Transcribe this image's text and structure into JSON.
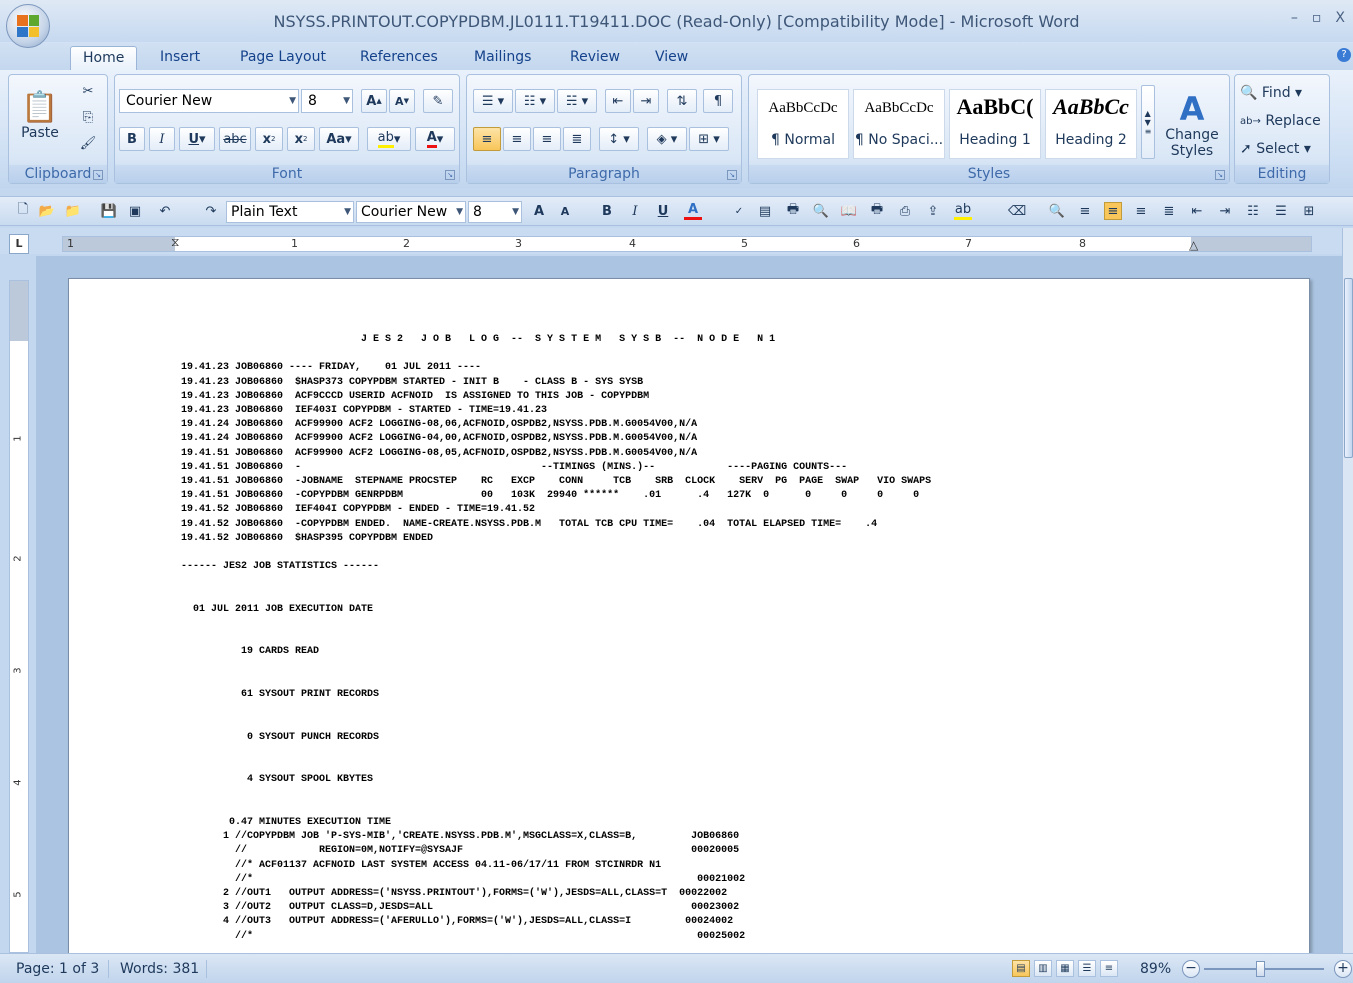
{
  "window": {
    "title": "NSYSS.PRINTOUT.COPYPDBM.JL0111.T19411.DOC (Read-Only) [Compatibility Mode] - Microsoft Word",
    "controls": {
      "minimize": "–",
      "maximize": "▫",
      "close": "X"
    }
  },
  "tabs": [
    "Home",
    "Insert",
    "Page Layout",
    "References",
    "Mailings",
    "Review",
    "View"
  ],
  "active_tab": "Home",
  "ribbon": {
    "clipboard": {
      "label": "Clipboard",
      "paste": "Paste"
    },
    "font": {
      "label": "Font",
      "font_name": "Courier New",
      "font_size": "8"
    },
    "paragraph": {
      "label": "Paragraph"
    },
    "styles": {
      "label": "Styles",
      "gallery": [
        {
          "sample": "AaBbCcDc",
          "name": "¶ Normal"
        },
        {
          "sample": "AaBbCcDc",
          "name": "¶ No Spaci..."
        },
        {
          "sample": "AaBbC(",
          "name": "Heading 1"
        },
        {
          "sample": "AaBbCc",
          "name": "Heading 2"
        }
      ],
      "change_styles": "Change",
      "change_styles2": "Styles"
    },
    "editing": {
      "label": "Editing",
      "find": "Find",
      "replace": "Replace",
      "select": "Select"
    }
  },
  "quick_toolbar": {
    "style": "Plain Text",
    "font": "Courier New",
    "size": "8"
  },
  "ruler": {
    "numbers": [
      "1",
      "1",
      "2",
      "3",
      "4",
      "5",
      "6",
      "7",
      "8"
    ]
  },
  "vruler": {
    "numbers": [
      "1",
      "2",
      "3",
      "4",
      "5"
    ]
  },
  "document": {
    "lines": [
      "                              J E S 2   J O B   L O G  --  S Y S T E M   S Y S B  --  N O D E   N 1",
      "",
      "19.41.23 JOB06860 ---- FRIDAY,    01 JUL 2011 ----",
      "19.41.23 JOB06860  $HASP373 COPYPDBM STARTED - INIT B    - CLASS B - SYS SYSB",
      "19.41.23 JOB06860  ACF9CCCD USERID ACFNOID  IS ASSIGNED TO THIS JOB - COPYPDBM",
      "19.41.23 JOB06860  IEF403I COPYPDBM - STARTED - TIME=19.41.23",
      "19.41.24 JOB06860  ACF99900 ACF2 LOGGING-08,06,ACFNOID,OSPDB2,NSYSS.PDB.M.G0054V00,N/A",
      "19.41.24 JOB06860  ACF99900 ACF2 LOGGING-04,00,ACFNOID,OSPDB2,NSYSS.PDB.M.G0054V00,N/A",
      "19.41.51 JOB06860  ACF99900 ACF2 LOGGING-08,05,ACFNOID,OSPDB2,NSYSS.PDB.M.G0054V00,N/A",
      "19.41.51 JOB06860  -                                        --TIMINGS (MINS.)--            ----PAGING COUNTS---",
      "19.41.51 JOB06860  -JOBNAME  STEPNAME PROCSTEP    RC   EXCP    CONN     TCB    SRB  CLOCK    SERV  PG  PAGE  SWAP   VIO SWAPS",
      "19.41.51 JOB06860  -COPYPDBM GENRPDBM             00   103K  29940 ******    .01      .4   127K  0      0     0     0     0",
      "19.41.52 JOB06860  IEF404I COPYPDBM - ENDED - TIME=19.41.52",
      "19.41.52 JOB06860  -COPYPDBM ENDED.  NAME-CREATE.NSYSS.PDB.M   TOTAL TCB CPU TIME=    .04  TOTAL ELAPSED TIME=    .4",
      "19.41.52 JOB06860  $HASP395 COPYPDBM ENDED",
      "",
      "------ JES2 JOB STATISTICS ------",
      "",
      "",
      "  01 JUL 2011 JOB EXECUTION DATE",
      "",
      "",
      "          19 CARDS READ",
      "",
      "",
      "          61 SYSOUT PRINT RECORDS",
      "",
      "",
      "           0 SYSOUT PUNCH RECORDS",
      "",
      "",
      "           4 SYSOUT SPOOL KBYTES",
      "",
      "",
      "        0.47 MINUTES EXECUTION TIME",
      "       1 //COPYPDBM JOB 'P-SYS-MIB','CREATE.NSYSS.PDB.M',MSGCLASS=X,CLASS=B,         JOB06860",
      "         //            REGION=0M,NOTIFY=@SYSAJF                                      00020005",
      "         //* ACF01137 ACFNOID LAST SYSTEM ACCESS 04.11-06/17/11 FROM STCINRDR N1",
      "         //*                                                                          00021002",
      "       2 //OUT1   OUTPUT ADDRESS=('NSYSS.PRINTOUT'),FORMS=('W'),JESDS=ALL,CLASS=T  00022002",
      "       3 //OUT2   OUTPUT CLASS=D,JESDS=ALL                                           00023002",
      "       4 //OUT3   OUTPUT ADDRESS=('AFERULLO'),FORMS=('W'),JESDS=ALL,CLASS=I         00024002",
      "         //*                                                                          00025002"
    ]
  },
  "status": {
    "page": "Page: 1 of 3",
    "words": "Words: 381",
    "zoom": "89%"
  }
}
